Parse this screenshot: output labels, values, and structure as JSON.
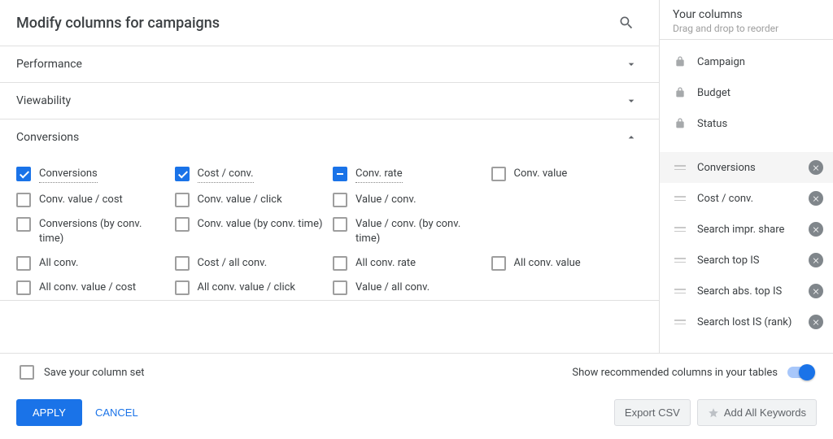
{
  "header": {
    "title": "Modify columns for campaigns"
  },
  "sections": [
    {
      "name": "Performance",
      "expanded": false
    },
    {
      "name": "Viewability",
      "expanded": false
    },
    {
      "name": "Conversions",
      "expanded": true
    }
  ],
  "options": [
    {
      "label": "Conversions",
      "state": "checked",
      "dotted": true
    },
    {
      "label": "Cost / conv.",
      "state": "checked",
      "dotted": true
    },
    {
      "label": "Conv. rate",
      "state": "mixed",
      "dotted": true
    },
    {
      "label": "Conv. value",
      "state": "off",
      "dotted": false
    },
    {
      "label": "Conv. value / cost",
      "state": "off",
      "dotted": false
    },
    {
      "label": "Conv. value / click",
      "state": "off",
      "dotted": false
    },
    {
      "label": "Value / conv.",
      "state": "off",
      "dotted": false
    },
    {
      "label": "",
      "state": "none",
      "dotted": false
    },
    {
      "label": "Conversions (by conv. time)",
      "state": "off",
      "dotted": false
    },
    {
      "label": "Conv. value (by conv. time)",
      "state": "off",
      "dotted": false
    },
    {
      "label": "Value / conv. (by conv. time)",
      "state": "off",
      "dotted": false
    },
    {
      "label": "",
      "state": "none",
      "dotted": false
    },
    {
      "label": "All conv.",
      "state": "off",
      "dotted": false
    },
    {
      "label": "Cost / all conv.",
      "state": "off",
      "dotted": false
    },
    {
      "label": "All conv. rate",
      "state": "off",
      "dotted": false
    },
    {
      "label": "All conv. value",
      "state": "off",
      "dotted": false
    },
    {
      "label": "All conv. value / cost",
      "state": "off",
      "dotted": false
    },
    {
      "label": "All conv. value / click",
      "state": "off",
      "dotted": false
    },
    {
      "label": "Value / all conv.",
      "state": "off",
      "dotted": false
    }
  ],
  "side": {
    "title": "Your columns",
    "subtitle": "Drag and drop to reorder",
    "locked": [
      "Campaign",
      "Budget",
      "Status"
    ],
    "draggable": [
      {
        "label": "Conversions",
        "active": true
      },
      {
        "label": "Cost / conv.",
        "active": false
      },
      {
        "label": "Search impr. share",
        "active": false
      },
      {
        "label": "Search top IS",
        "active": false
      },
      {
        "label": "Search abs. top IS",
        "active": false
      },
      {
        "label": "Search lost IS (rank)",
        "active": false
      }
    ]
  },
  "footer": {
    "save_set": "Save your column set",
    "recommend": "Show recommended columns in your tables",
    "apply": "APPLY",
    "cancel": "CANCEL",
    "export_csv": "Export CSV",
    "add_keywords": "Add All Keywords"
  }
}
